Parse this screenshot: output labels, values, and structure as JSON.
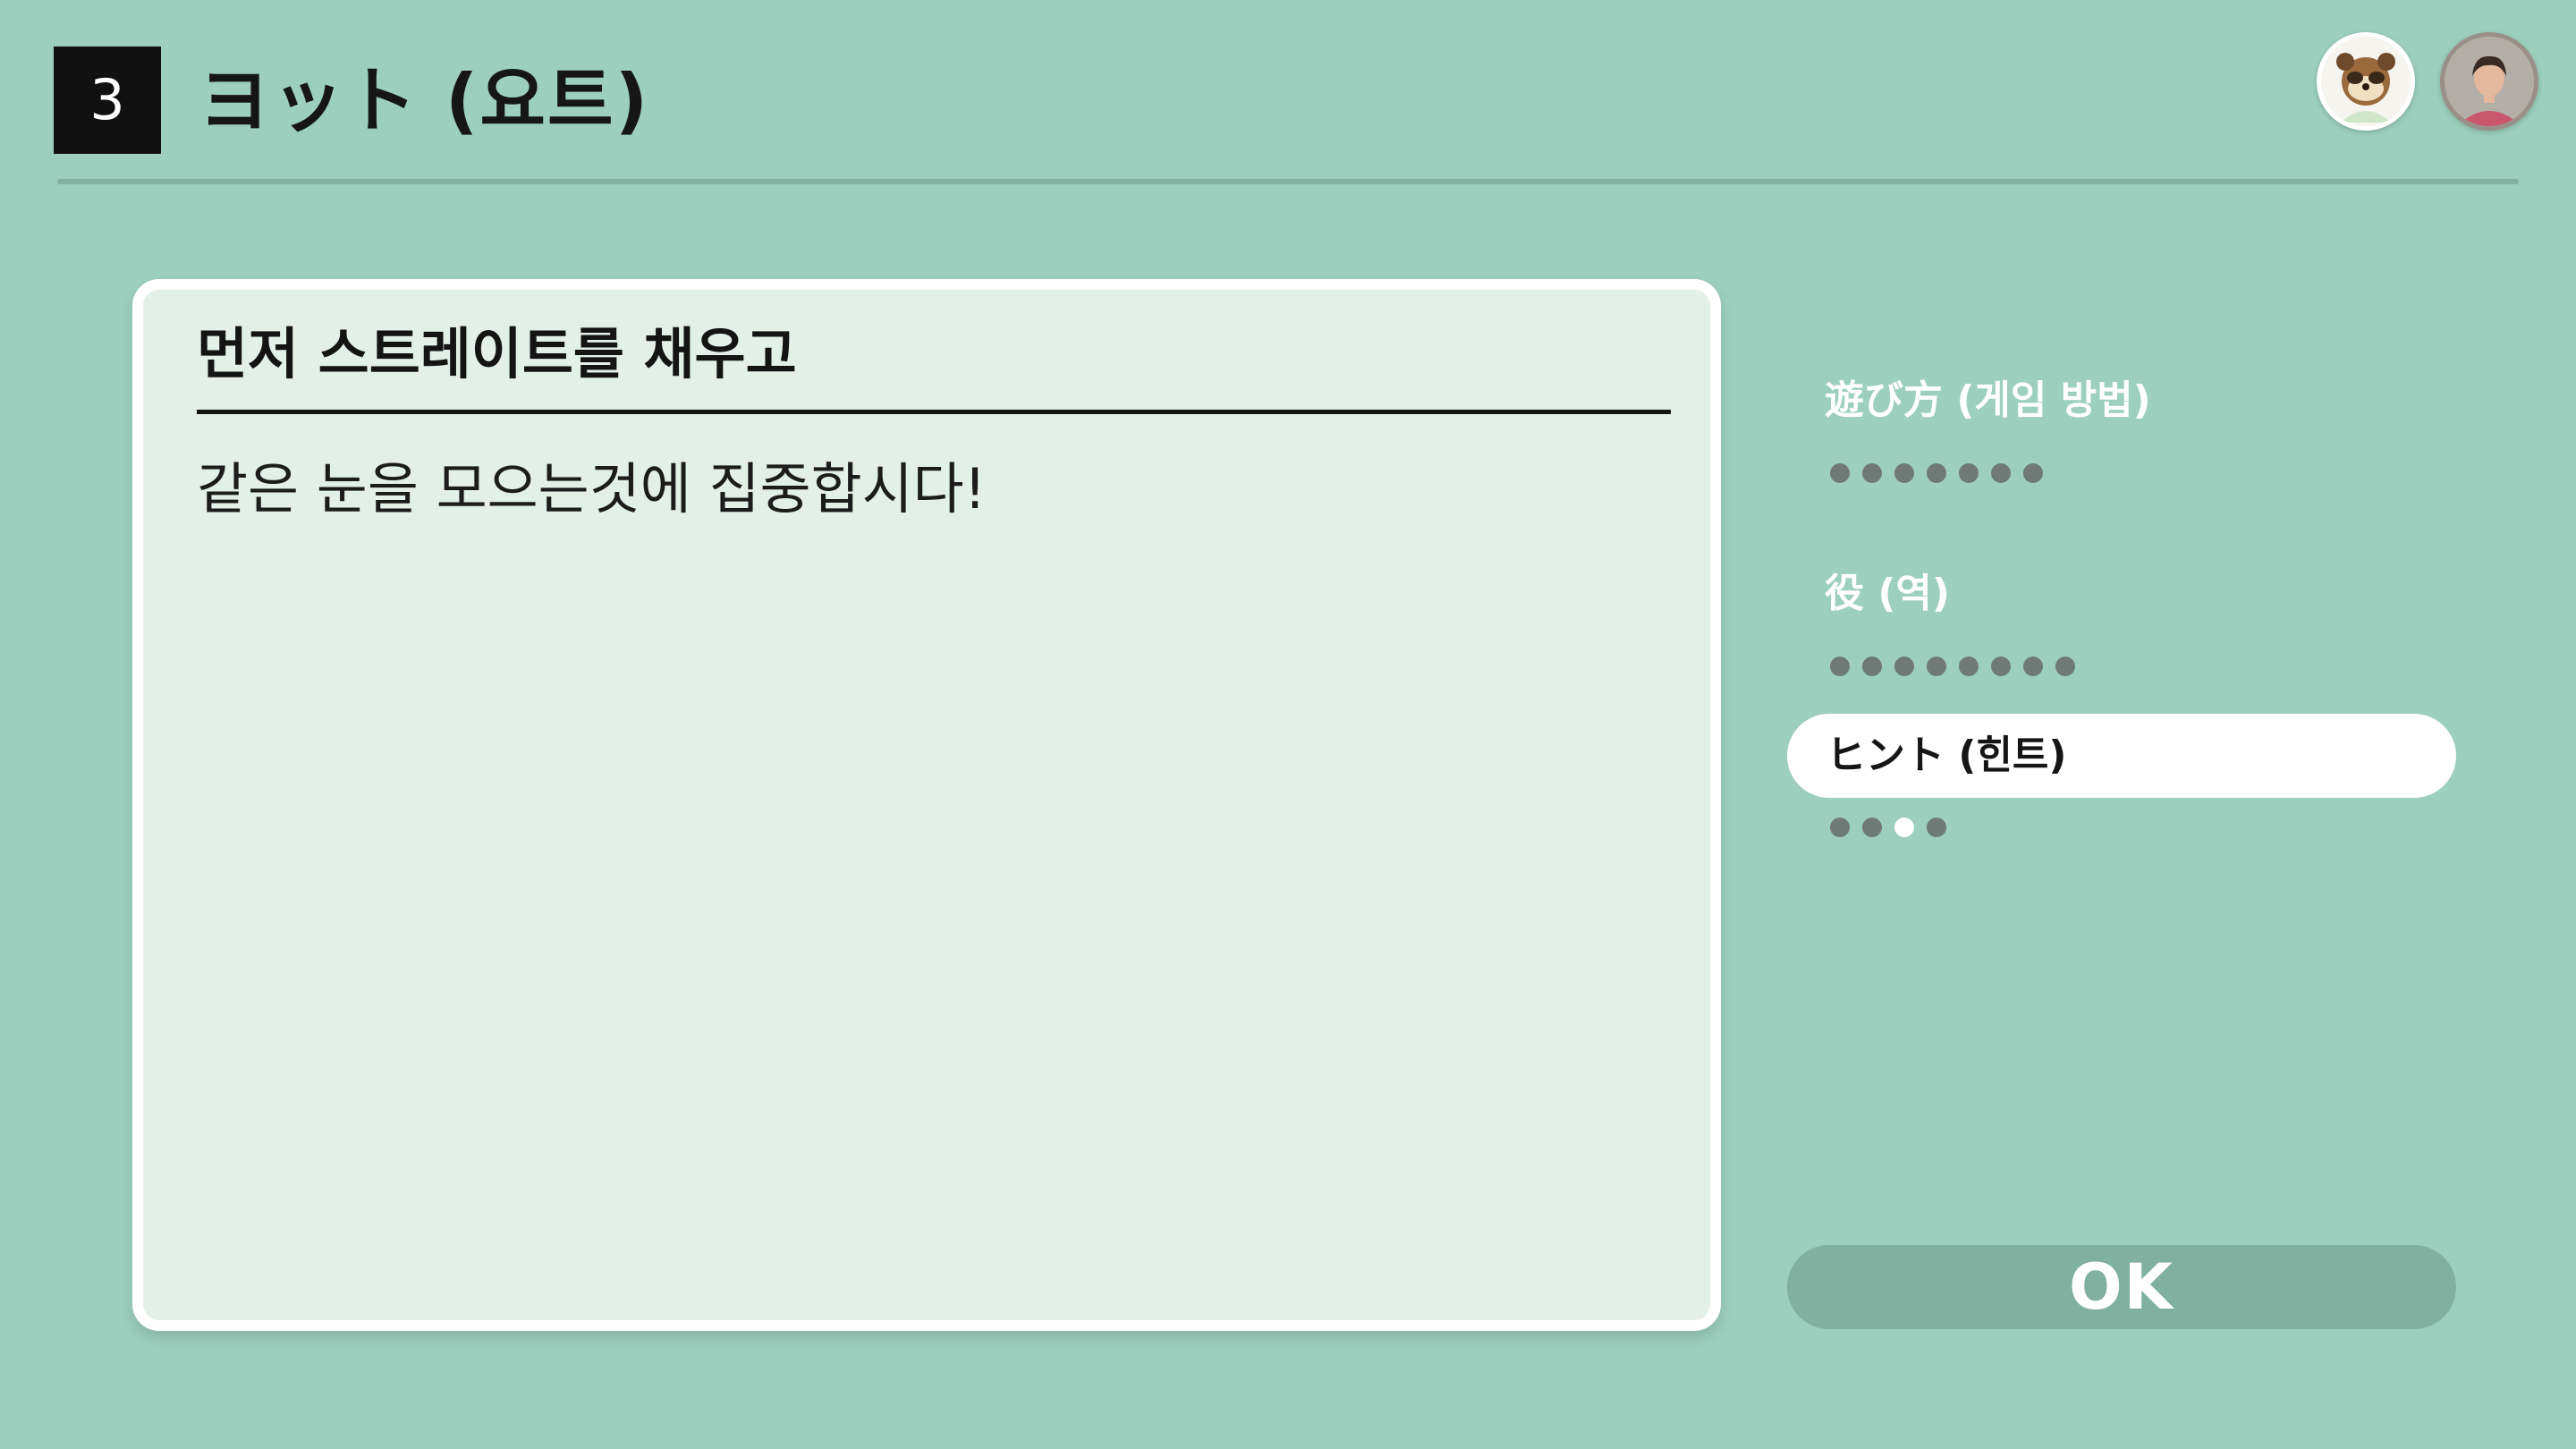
{
  "header": {
    "step_number": "3",
    "title": "ヨット (요트)"
  },
  "avatars": [
    {
      "icon": "tanuki-character-avatar"
    },
    {
      "icon": "player-avatar"
    }
  ],
  "panel": {
    "heading": "먼저 스트레이트를 채우고",
    "body": "같은 눈을 모으는것에 집중합시다!"
  },
  "menu": {
    "items": [
      {
        "label": "遊び方 (게임 방법)",
        "pages": 7,
        "current_page": null,
        "active": false
      },
      {
        "label": "役 (역)",
        "pages": 8,
        "current_page": null,
        "active": false
      },
      {
        "label": "ヒント (힌트)",
        "pages": 4,
        "current_page": 3,
        "active": true
      }
    ]
  },
  "ok_button": {
    "label": "OK"
  },
  "colors": {
    "background": "#9ccfbd",
    "panel": "#e3f0e7",
    "ok_button": "#80b0a0",
    "dot": "#6f7a76"
  }
}
